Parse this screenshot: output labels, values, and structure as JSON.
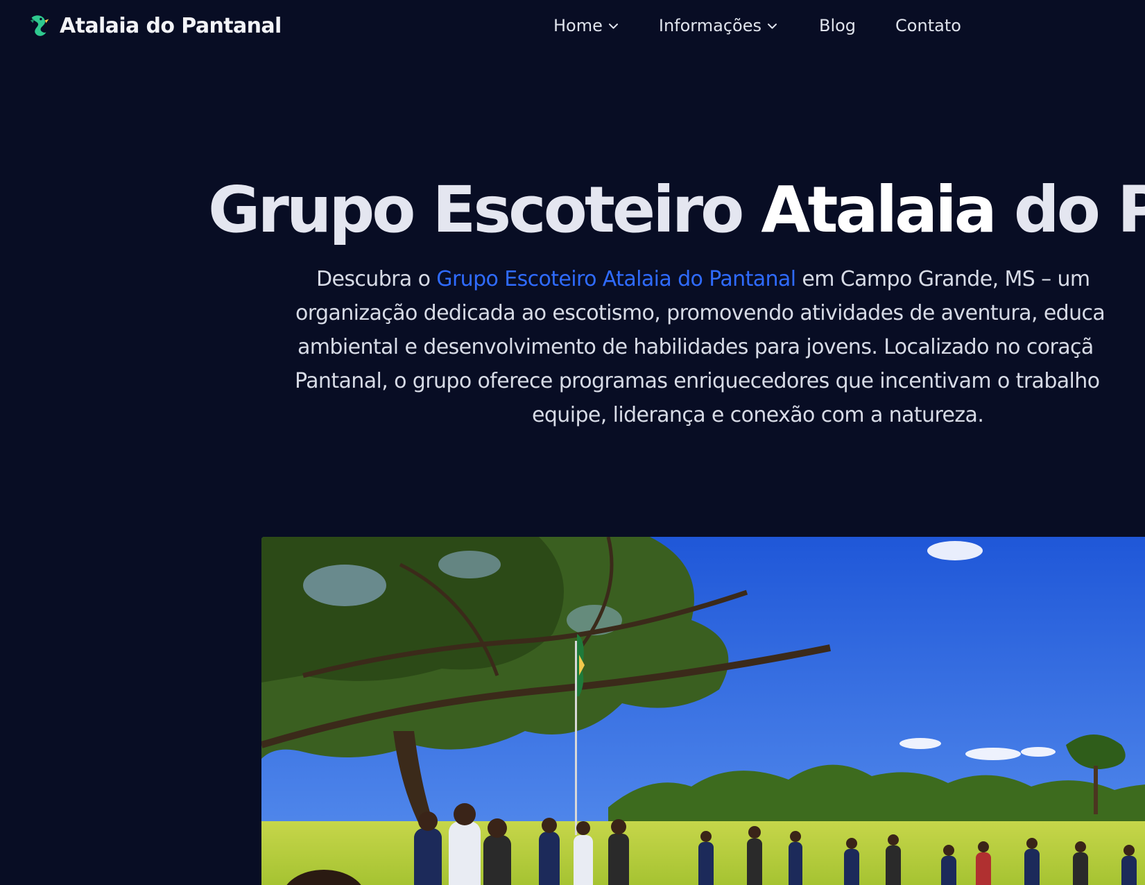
{
  "header": {
    "brand_name": "Atalaia do Pantanal",
    "nav": [
      {
        "label": "Home",
        "has_dropdown": true
      },
      {
        "label": "Informações",
        "has_dropdown": true
      },
      {
        "label": "Blog",
        "has_dropdown": false
      },
      {
        "label": "Contato",
        "has_dropdown": false
      }
    ]
  },
  "hero": {
    "title_part1": "Grupo Escoteiro ",
    "title_part2": "Atalaia",
    "title_part3": " do Pan",
    "description": {
      "line1_prefix": "Descubra o ",
      "line1_link": "Grupo Escoteiro Atalaia do Pantanal",
      "line1_suffix": " em Campo Grande, MS – um",
      "line2": "organização dedicada ao escotismo, promovendo atividades de aventura, educa",
      "line3": "ambiental e desenvolvimento de habilidades para jovens. Localizado no coraçã",
      "line4": "Pantanal, o grupo oferece programas enriquecedores que incentivam o trabalho",
      "line5": "equipe, liderança e conexão com a natureza."
    }
  },
  "photo": {
    "subject": "scouts-flag-ceremony-photo"
  },
  "colors": {
    "background": "#080d24",
    "link": "#2f6bff",
    "logo_accent": "#2fc98f",
    "sky": "#2f67e3"
  },
  "icons": {
    "logo": "dragon-logo-icon",
    "dropdown": "chevron-down-icon"
  }
}
